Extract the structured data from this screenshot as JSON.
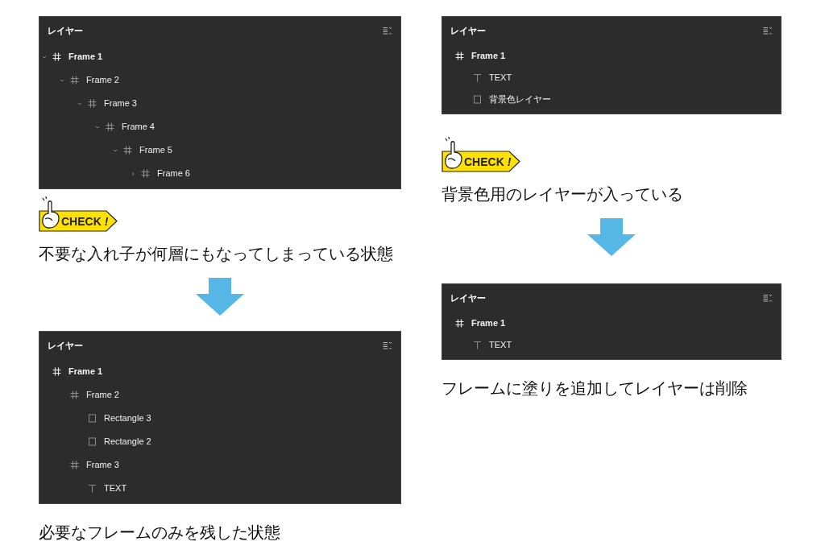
{
  "left_column": [
    {
      "kind": "panel",
      "title": "レイヤー",
      "layers": [
        {
          "name": "Frame 1",
          "kind": "frame",
          "expanded": true,
          "children": [
            {
              "name": "Frame 2",
              "kind": "frame",
              "expanded": true,
              "children": [
                {
                  "name": "Frame 3",
                  "kind": "frame",
                  "expanded": true,
                  "children": [
                    {
                      "name": "Frame 4",
                      "kind": "frame",
                      "expanded": true,
                      "children": [
                        {
                          "name": "Frame 5",
                          "kind": "frame",
                          "expanded": true,
                          "children": [
                            {
                              "name": "Frame 6",
                              "kind": "frame",
                              "expanded": false
                            }
                          ]
                        }
                      ]
                    }
                  ]
                }
              ]
            }
          ]
        }
      ]
    },
    {
      "kind": "check",
      "label": "CHECK *!*"
    },
    {
      "kind": "caption",
      "text": "不要な入れ子が何層にもなってしまっている状態"
    },
    {
      "kind": "arrow"
    },
    {
      "kind": "panel",
      "title": "レイヤー",
      "layers": [
        {
          "name": "Frame 1",
          "kind": "frame",
          "children": [
            {
              "name": "Frame 2",
              "kind": "frame",
              "children": [
                {
                  "name": "Rectangle 3",
                  "kind": "rectangle"
                },
                {
                  "name": "Rectangle 2",
                  "kind": "rectangle"
                }
              ]
            },
            {
              "name": "Frame 3",
              "kind": "frame",
              "children": [
                {
                  "name": "TEXT",
                  "kind": "text"
                }
              ]
            }
          ]
        }
      ]
    },
    {
      "kind": "caption",
      "text": "必要なフレームのみを残した状態"
    }
  ],
  "right_column": [
    {
      "kind": "panel",
      "title": "レイヤー",
      "layers": [
        {
          "name": "Frame 1",
          "kind": "frame",
          "children": [
            {
              "name": "TEXT",
              "kind": "text"
            },
            {
              "name": "背景色レイヤー",
              "kind": "rectangle"
            }
          ]
        }
      ]
    },
    {
      "kind": "check",
      "label": "CHECK *!*"
    },
    {
      "kind": "caption",
      "text": "背景色用のレイヤーが入っている"
    },
    {
      "kind": "arrow"
    },
    {
      "kind": "panel",
      "title": "レイヤー",
      "layers": [
        {
          "name": "Frame 1",
          "kind": "frame",
          "children": [
            {
              "name": "TEXT",
              "kind": "text"
            }
          ]
        }
      ]
    },
    {
      "kind": "caption",
      "text": "フレームに塗りを追加してレイヤーは削除"
    }
  ]
}
